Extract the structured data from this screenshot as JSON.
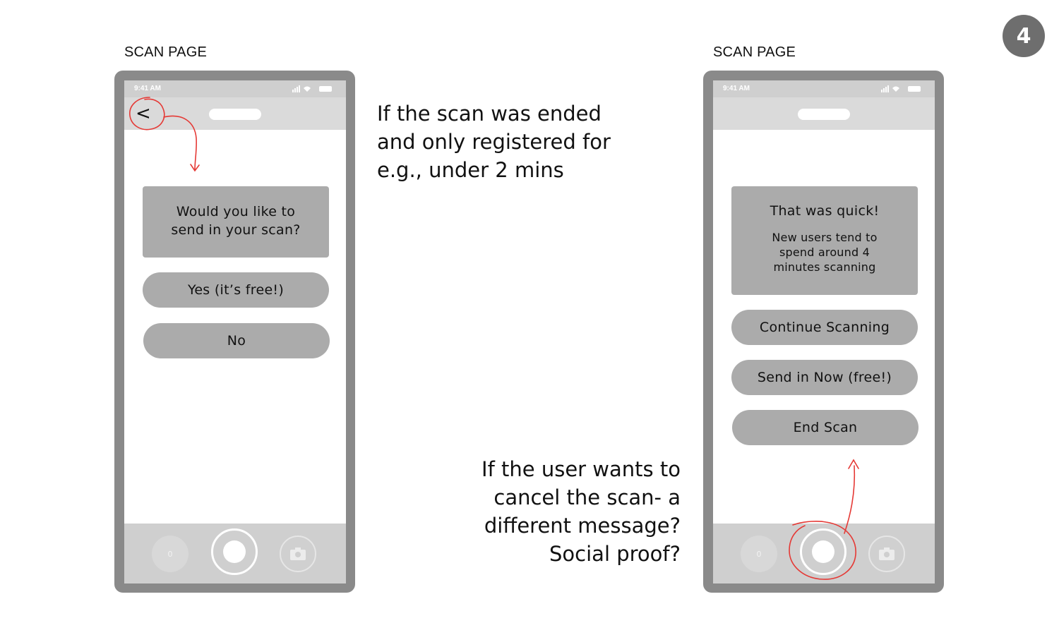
{
  "slide_number": "4",
  "left": {
    "page_label": "SCAN PAGE",
    "status_time": "9:41 AM",
    "back_glyph": "<",
    "prompt_line1": "Would you like to",
    "prompt_line2": "send in your scan?",
    "yes_button": "Yes (it’s free!)",
    "no_button": "No",
    "counter": "0"
  },
  "right": {
    "page_label": "SCAN PAGE",
    "status_time": "9:41 AM",
    "title": "That was quick!",
    "body_line1": "New users tend to",
    "body_line2": "spend around 4",
    "body_line3": "minutes scanning",
    "continue_button": "Continue Scanning",
    "send_button": "Send in Now (free!)",
    "end_button": "End Scan",
    "counter": "0"
  },
  "notes": {
    "top": [
      "If the scan was ended",
      "and only registered for",
      "e.g., under 2 mins"
    ],
    "bottom": [
      "If the user wants to",
      "cancel the scan- a",
      "different message?",
      "Social proof?"
    ]
  },
  "colors": {
    "annotation": "#e53935",
    "phone_frame": "#8a8a8a",
    "button": "#ababab"
  },
  "icons": [
    "chevron-left-icon",
    "signal-icon",
    "wifi-icon",
    "battery-icon",
    "camera-icon",
    "shutter-icon"
  ]
}
